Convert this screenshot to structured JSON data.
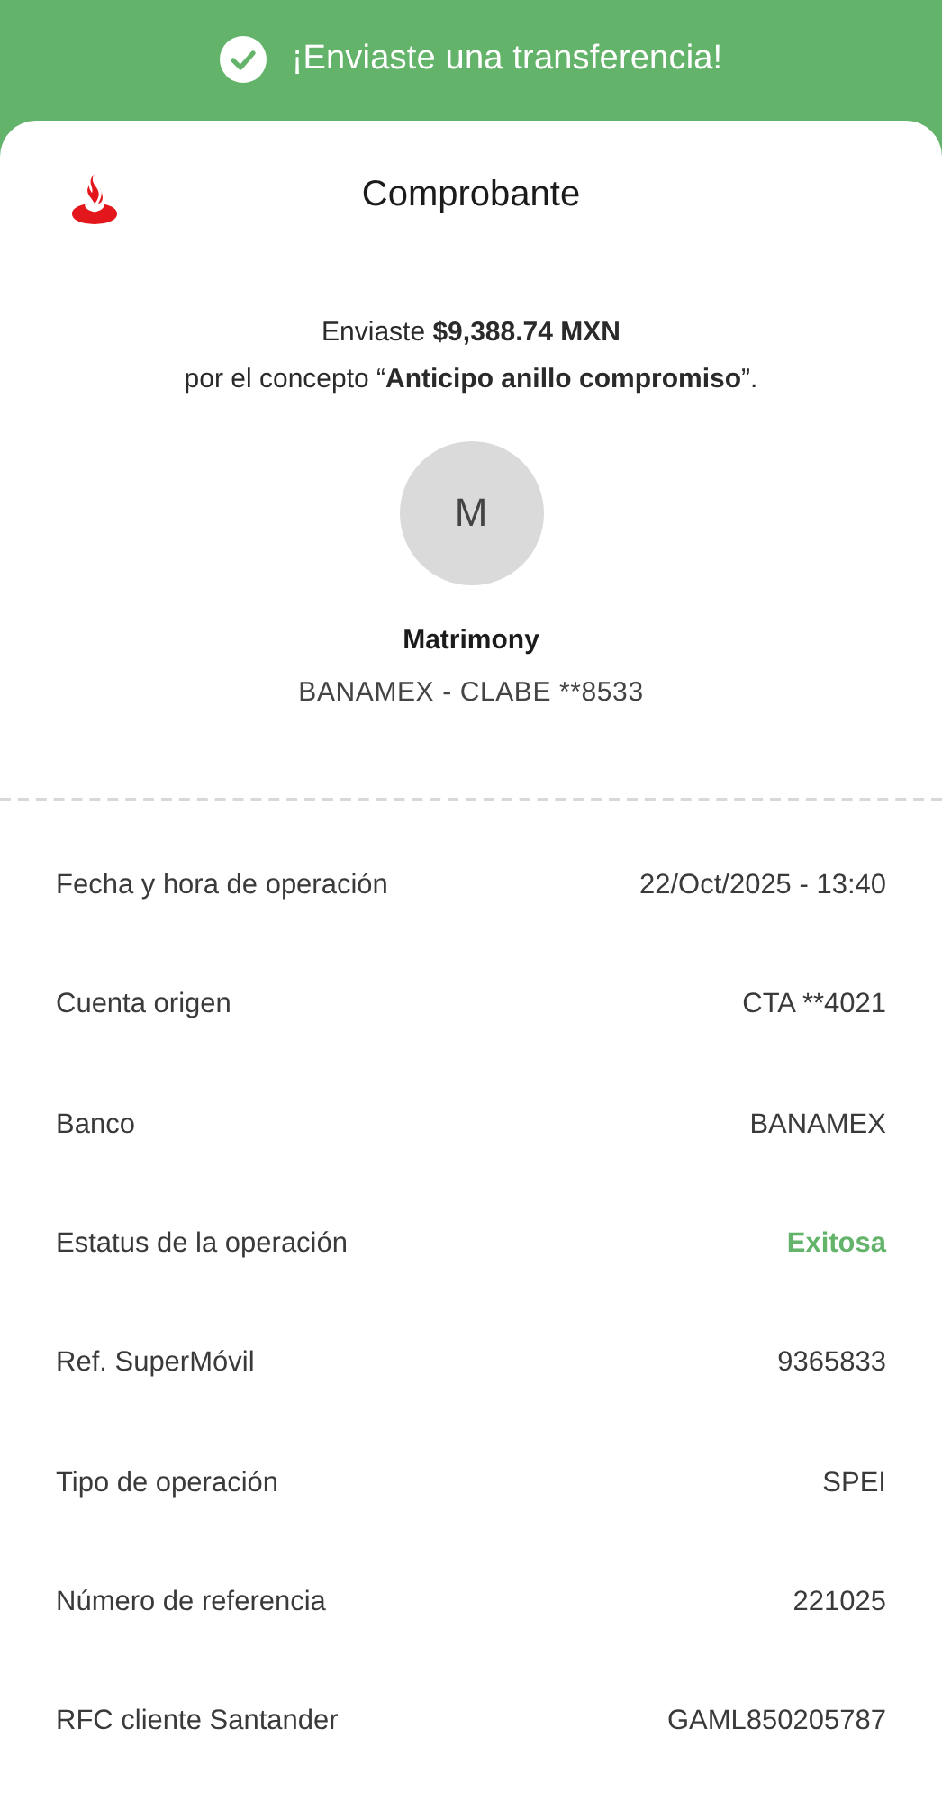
{
  "banner": {
    "title": "¡Enviaste una transferencia!"
  },
  "receipt": {
    "title": "Comprobante",
    "summary": [
      "Enviaste **$9,388.74 MXN**",
      "por el concepto “**Anticipo anillo compromiso**”."
    ],
    "recipient": {
      "initial": "M",
      "name": "Matrimony",
      "account": "BANAMEX - CLABE **8533"
    },
    "details": [
      {
        "label": "Fecha y hora de operación",
        "value": "22/Oct/2025 - 13:40",
        "kind": "text"
      },
      {
        "label": "Cuenta origen",
        "value": "CTA **4021",
        "kind": "text"
      },
      {
        "label": "Banco",
        "value": "BANAMEX",
        "kind": "text"
      },
      {
        "label": "Estatus de la operación",
        "value": "Exitosa",
        "kind": "status"
      },
      {
        "label": "Ref. SuperMóvil",
        "value": "9365833",
        "kind": "text"
      },
      {
        "label": "Tipo de operación",
        "value": "SPEI",
        "kind": "text"
      },
      {
        "label": "Número de referencia",
        "value": "221025",
        "kind": "text"
      },
      {
        "label": "RFC cliente Santander",
        "value": "GAML850205787",
        "kind": "text"
      }
    ]
  }
}
